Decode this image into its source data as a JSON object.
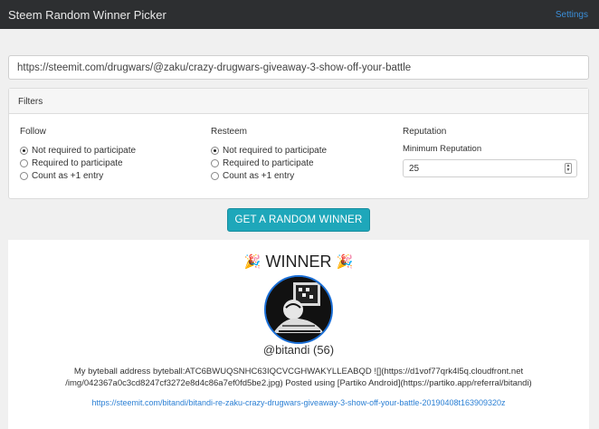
{
  "navbar": {
    "brand": "Steem Random Winner Picker",
    "settings_label": "Settings"
  },
  "url_input": {
    "value": "https://steemit.com/drugwars/@zaku/crazy-drugwars-giveaway-3-show-off-your-battle"
  },
  "filters": {
    "title": "Filters",
    "follow": {
      "title": "Follow",
      "options": [
        "Not required to participate",
        "Required to participate",
        "Count as +1 entry"
      ],
      "selected": 0
    },
    "resteem": {
      "title": "Resteem",
      "options": [
        "Not required to participate",
        "Required to participate",
        "Count as +1 entry"
      ],
      "selected": 0
    },
    "reputation": {
      "title": "Reputation",
      "min_label": "Minimum Reputation",
      "value": "25"
    }
  },
  "action": {
    "button_label": "GET A RANDOM WINNER"
  },
  "winner": {
    "heading": "WINNER",
    "username": "@bitandi (56)",
    "comment_line1": "My byteball address byteball:ATC6BWUQSNHC63IQCVCGHWAKYLLEABQD ![](https://d1vof77qrk4l5q.cloudfront.net",
    "comment_line2": "/img/042367a0c3cd8247cf3272e8d4c86a7ef0fd5be2.jpg) Posted using [Partiko Android](https://partiko.app/referral/bitandi)",
    "permalink": "https://steemit.com/bitandi/bitandi-re-zaku-crazy-drugwars-giveaway-3-show-off-your-battle-20190408t163909320z"
  },
  "colors": {
    "navbar_bg": "#2d2f31",
    "accent_button": "#1ea7ba",
    "link": "#2a7fd4",
    "avatar_ring": "#1b6fd6"
  }
}
